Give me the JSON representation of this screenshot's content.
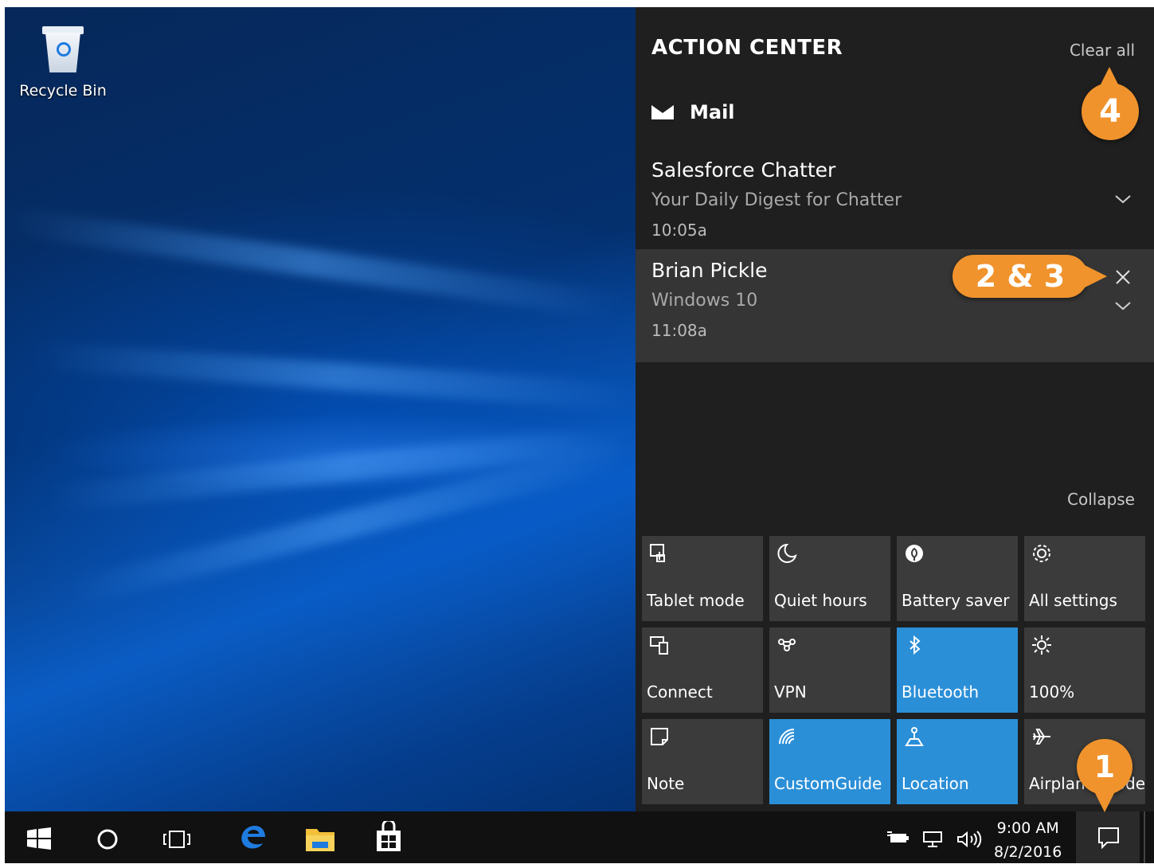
{
  "desktop": {
    "recycle_bin_label": "Recycle Bin"
  },
  "action_center": {
    "title": "ACTION CENTER",
    "clear_all": "Clear all",
    "app_group": "Mail",
    "notifications": [
      {
        "sender": "Salesforce Chatter",
        "message": "Your Daily Digest for Chatter",
        "time": "10:05a"
      },
      {
        "sender": "Brian Pickle",
        "message": "Windows 10",
        "time": "11:08a"
      }
    ],
    "collapse": "Collapse",
    "quick_actions": [
      {
        "label": "Tablet mode",
        "icon": "tablet-mode-icon",
        "on": false
      },
      {
        "label": "Quiet hours",
        "icon": "moon-icon",
        "on": false
      },
      {
        "label": "Battery saver",
        "icon": "battery-saver-icon",
        "on": false
      },
      {
        "label": "All settings",
        "icon": "gear-icon",
        "on": false
      },
      {
        "label": "Connect",
        "icon": "connect-icon",
        "on": false
      },
      {
        "label": "VPN",
        "icon": "vpn-icon",
        "on": false
      },
      {
        "label": "Bluetooth",
        "icon": "bluetooth-icon",
        "on": true
      },
      {
        "label": "100%",
        "icon": "brightness-icon",
        "on": false
      },
      {
        "label": "Note",
        "icon": "note-icon",
        "on": false
      },
      {
        "label": "CustomGuide",
        "icon": "wifi-icon",
        "on": true
      },
      {
        "label": "Location",
        "icon": "location-icon",
        "on": true
      },
      {
        "label": "Airplane mode",
        "icon": "airplane-icon",
        "on": false
      }
    ],
    "accent_color": "#2b8fd8"
  },
  "taskbar": {
    "time": "9:00 AM",
    "date": "8/2/2016"
  },
  "callouts": {
    "one": "1",
    "two_three": "2 & 3",
    "four": "4",
    "color": "#f0932d"
  }
}
